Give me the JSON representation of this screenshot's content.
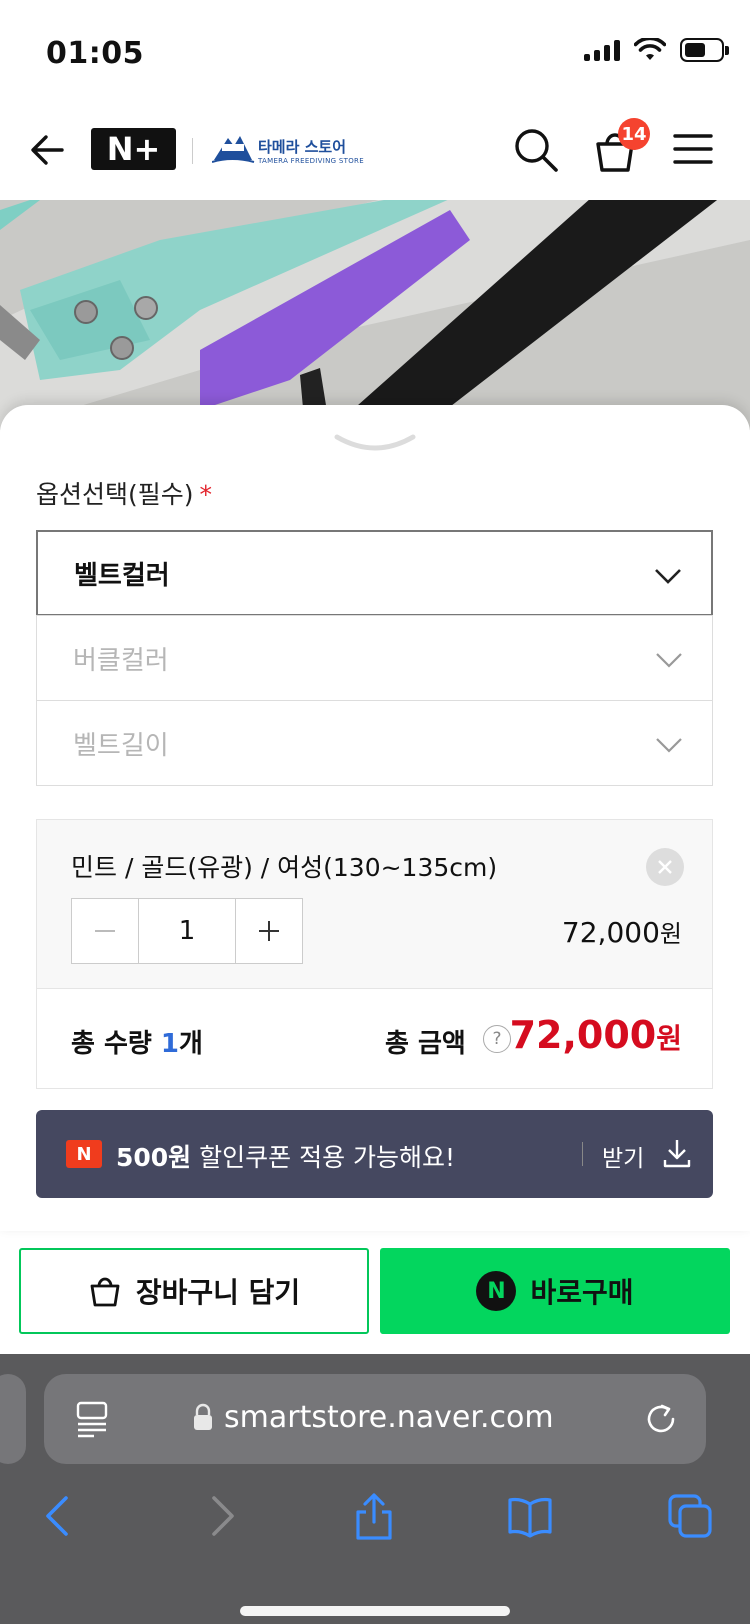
{
  "status_bar": {
    "time": "01:05"
  },
  "header": {
    "brand_badge": "N+",
    "store_name": "타메라 스토어",
    "store_sub": "TAMERA FREEDIVING STORE",
    "cart_count": "14"
  },
  "options": {
    "title": "옵션선택(필수)",
    "required_mark": "*",
    "selects": [
      {
        "label": "벨트컬러"
      },
      {
        "label": "버클컬러"
      },
      {
        "label": "벨트길이"
      }
    ]
  },
  "selected_item": {
    "name": "민트 / 골드(유광) / 여성(130~135cm)",
    "quantity": "1",
    "price": "72,000",
    "currency": "원"
  },
  "total": {
    "qty_prefix": "총 수량 ",
    "qty_num": "1",
    "qty_suffix": "개",
    "amount_label": "총 금액",
    "help": "?",
    "amount": "72,000",
    "currency": "원"
  },
  "coupon": {
    "icon": "N",
    "amount": "500원",
    "message": " 할인쿠폰 적용 가능해요!",
    "action": "받기"
  },
  "cta": {
    "cart": "장바구니 담기",
    "buy": "바로구매",
    "buy_icon": "N"
  },
  "browser": {
    "url": "smartstore.naver.com"
  },
  "colors": {
    "accent_green": "#03c75a",
    "price_red": "#d50c1f",
    "coupon_bg": "#454860",
    "badge_red": "#f5432f"
  }
}
